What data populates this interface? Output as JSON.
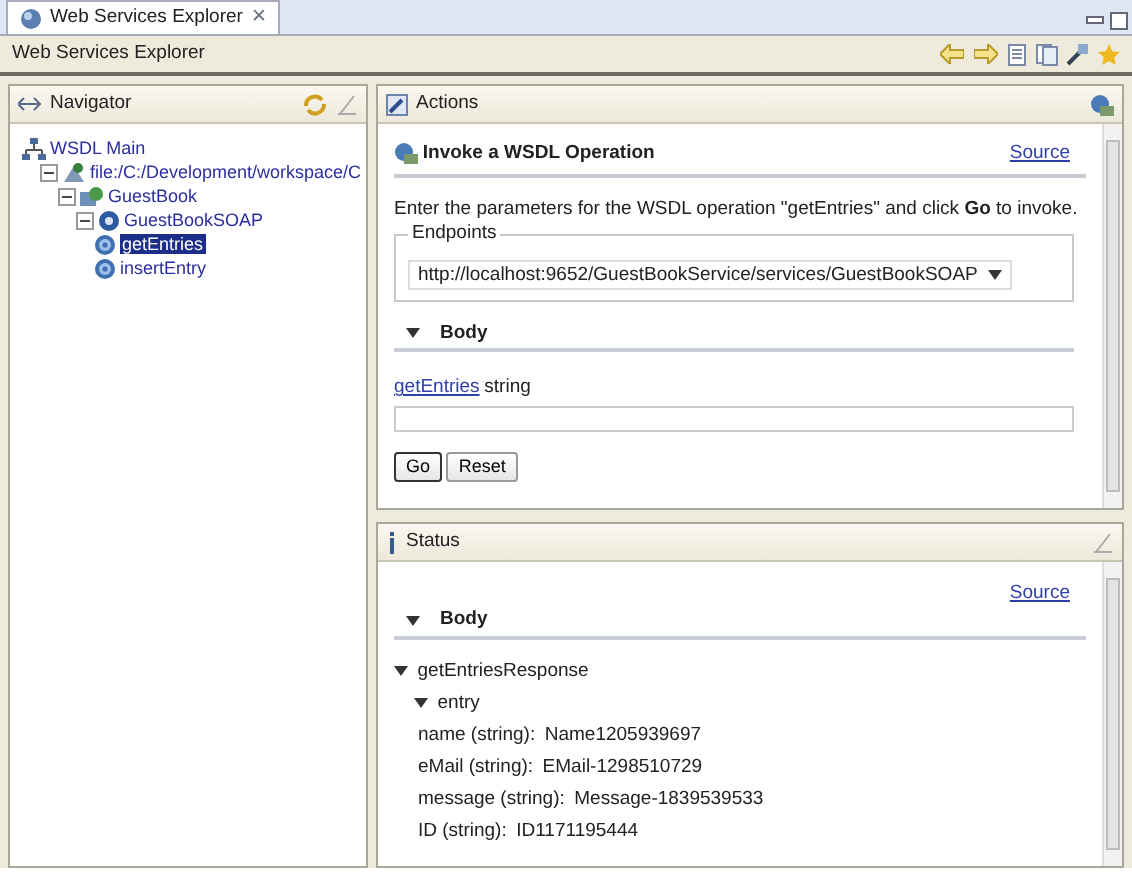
{
  "editor_tab": {
    "title": "Web Services Explorer",
    "close": "✕"
  },
  "toolbar": {
    "title": "Web Services Explorer"
  },
  "navigator": {
    "title": "Navigator",
    "tree": [
      {
        "label": "WSDL Main",
        "selected": false,
        "children": [
          {
            "label": "file:/C:/Development/workspace/C",
            "selected": false,
            "expanded": true,
            "children": [
              {
                "label": "GuestBook",
                "selected": false,
                "expanded": true,
                "children": [
                  {
                    "label": "GuestBookSOAP",
                    "selected": false,
                    "expanded": true,
                    "children": [
                      {
                        "label": "getEntries",
                        "selected": true
                      },
                      {
                        "label": "insertEntry",
                        "selected": false
                      }
                    ]
                  }
                ]
              }
            ]
          }
        ]
      }
    ]
  },
  "actions": {
    "title": "Actions",
    "heading": "Invoke a WSDL Operation",
    "source_link": "Source",
    "instruction": "Enter the parameters for the WSDL operation \"getEntries\" and click **Go** to invoke.",
    "endpoints": {
      "legend": "Endpoints",
      "value": "http://localhost:9652/GuestBookService/services/GuestBookSOAP"
    },
    "body": {
      "title": "Body",
      "expanded": true
    },
    "parameter": {
      "name": "getEntries",
      "type": "string"
    },
    "buttons": [
      {
        "label": "Go",
        "default": true
      },
      {
        "label": "Reset",
        "default": false
      }
    ]
  },
  "status": {
    "title": "Status",
    "source_link": "Source",
    "body": {
      "title": "Body",
      "expanded": true
    },
    "response": [
      {
        "label": "getEntriesResponse",
        "expanded": true,
        "children": [
          {
            "label": "entry",
            "expanded": true,
            "fields": [
              {
                "name": "name (string):",
                "value": "Name1205939697"
              },
              {
                "name": "eMail (string):",
                "value": "EMail-1298510729"
              },
              {
                "name": "message (string):",
                "value": "Message-1839539533"
              },
              {
                "name": "ID (string):",
                "value": "ID1171195444"
              }
            ]
          }
        ]
      }
    ]
  }
}
